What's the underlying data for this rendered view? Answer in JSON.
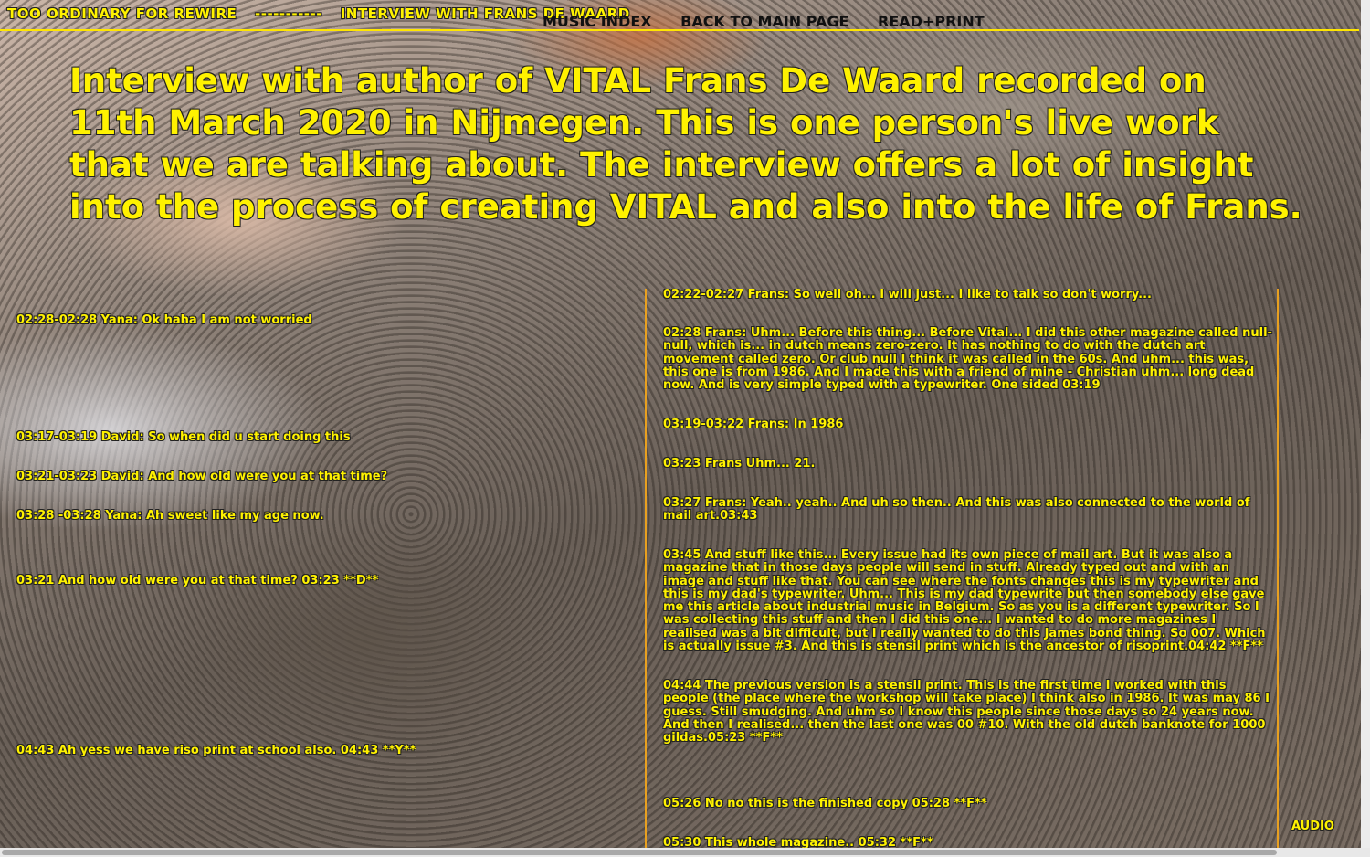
{
  "header": {
    "site_title": "TOO ORDINARY FOR REWIRE",
    "separator": "-----------",
    "page_title": "INTERVIEW WITH FRANS DE WAARD",
    "nav": [
      "MUSIC INDEX",
      "BACK TO MAIN PAGE",
      "READ+PRINT"
    ]
  },
  "headline": "Interview with author of VITAL Frans De Waard recorded on 11th March 2020 in Nijmegen. This is one person's live work that we are talking about. The interview offers a lot of insight into the process of creating VITAL and also into the life of Frans.",
  "left_messages": [
    "02:28-02:28 Yana: Ok haha I am not worried",
    "03:17-03:19 David: So when did u start doing this",
    "03:21-03:23 David: And how old were you at that time?",
    "03:28 -03:28 Yana: Ah sweet like my age now.",
    "03:21 And how old were you at that time? 03:23 **D**",
    "04:43 Ah yess we have riso print at school also. 04:43 **Y**"
  ],
  "right_messages": [
    "02:22-02:27 Frans: So well oh... I will just... I like to talk so don't worry...",
    "02:28 Frans: Uhm... Before this thing... Before Vital... I did this other magazine called null-null, which is... in dutch means zero-zero. It has nothing to do with the dutch art movement called zero. Or club null I think it was called in the 60s. And uhm... this was, this one is from 1986. And I made this with a friend of mine - Christian uhm... long dead now. And is very simple typed with a typewriter. One sided  03:19",
    "03:19-03:22 Frans: In 1986",
    "03:23 Frans Uhm... 21.",
    "03:27 Frans: Yeah.. yeah.. And uh so then.. And this was also connected to the world of mail art.03:43",
    "03:45 And stuff like this... Every issue had its own piece of mail art. But it was also a magazine that in those days people will send in stuff. Already typed out and with an image and stuff like that. You can see where the fonts changes this is my typewriter and this is my dad's typewriter. Uhm... This is my dad typewrite but then somebody else gave me this article about industrial music in Belgium. So as you is a different typewriter. So I was collecting this stuff and then I did this one... I wanted to do more magazines I realised was a bit difficult, but I really wanted to do this James bond thing. So 007. Which is actually issue #3. And this is stensil print which is the ancestor of risoprint.04:42 **F**",
    "04:44 The previous version is a stensil print. This is the first time I worked with this people (the place where the workshop will take place) I think also in 1986. It was may 86 I guess. Still smudging. And uhm so I know this people since those days so 24 years now. And then I realised... then the last one was 00 #10. With the old dutch banknote for 1000 gildas.05:23 **F**",
    "05:26 No no this is the finished copy 05:28 **F**",
    "05:30 This whole magazine.. 05:32 **F**"
  ],
  "audio_label": "AUDIO"
}
